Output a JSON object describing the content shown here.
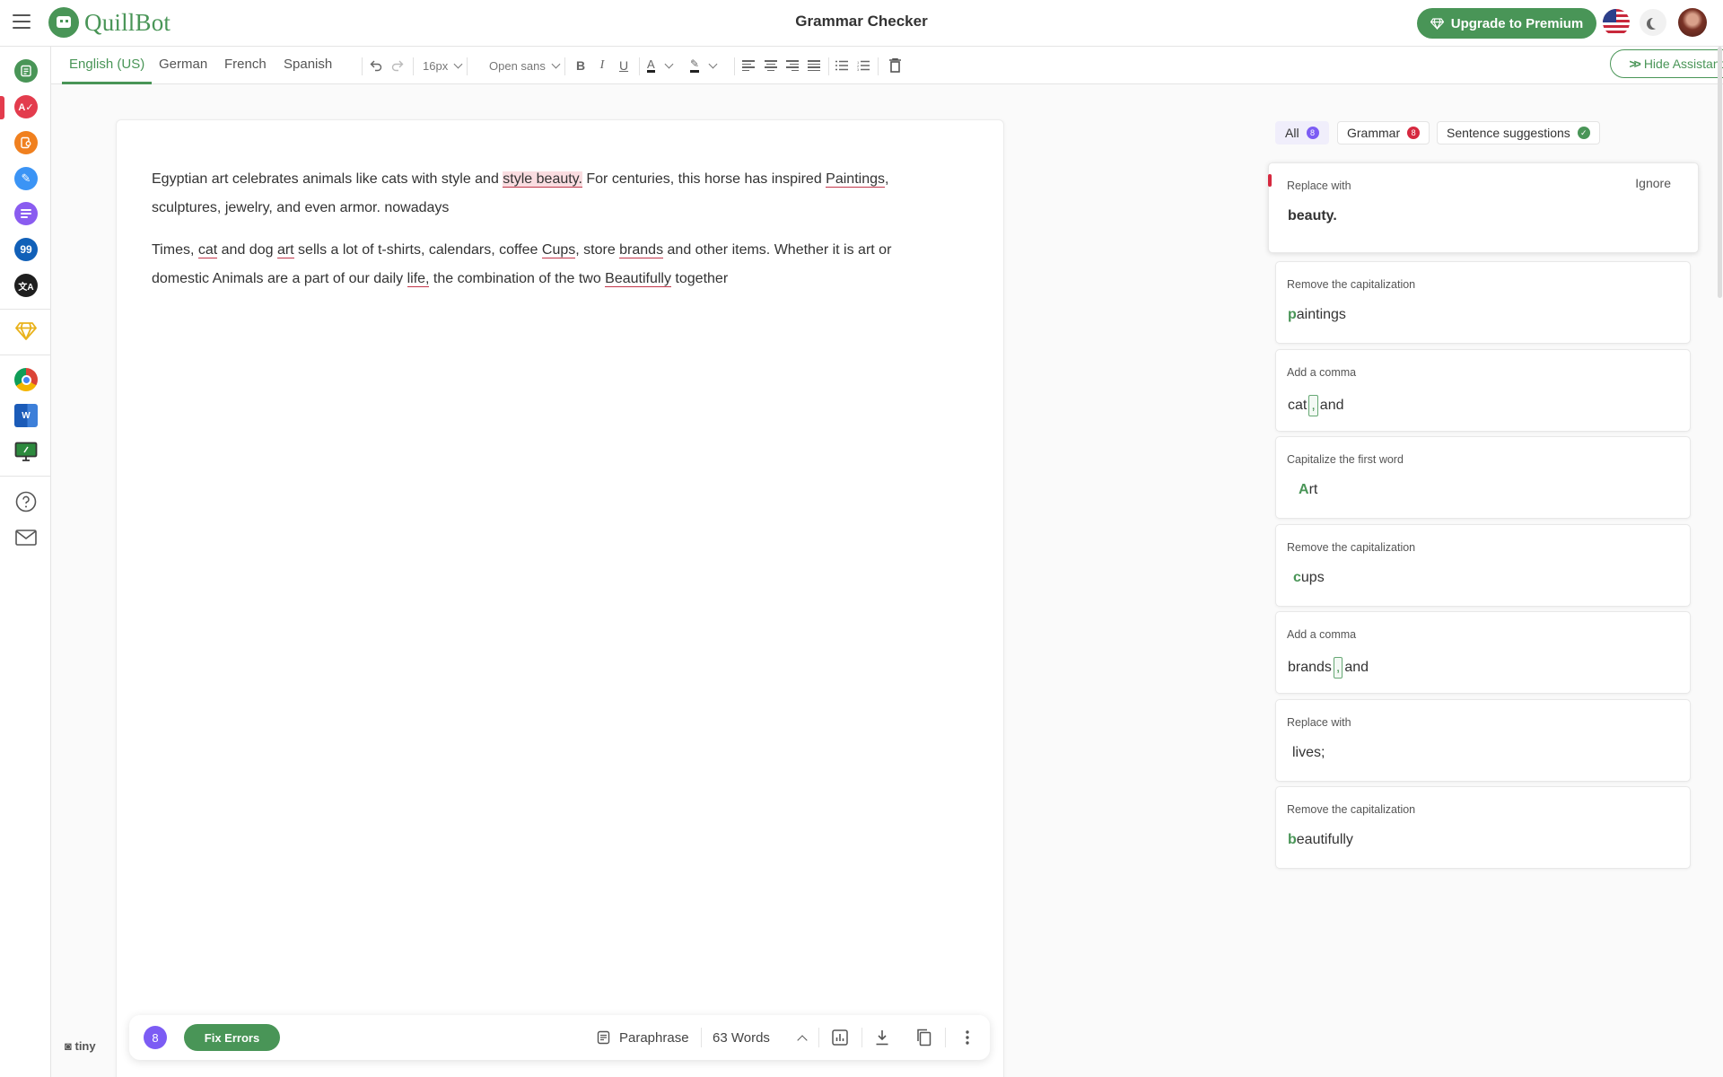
{
  "app": {
    "brand": "QuillBot",
    "page_title": "Grammar Checker",
    "upgrade_label": "Upgrade to Premium",
    "colors": {
      "brand_green": "#499557",
      "error_red": "#c2364a",
      "badge_purple": "#7c5cf4"
    }
  },
  "rail": {
    "items": [
      {
        "name": "paraphraser",
        "color": "#499557",
        "glyph": "⇄"
      },
      {
        "name": "grammar-checker",
        "color": "#e33c4d",
        "glyph": "A✓",
        "active": true
      },
      {
        "name": "plagiarism-checker",
        "color": "#f0801f",
        "glyph": "⌕"
      },
      {
        "name": "ai-writer",
        "color": "#3b94f5",
        "glyph": "✎"
      },
      {
        "name": "summarizer",
        "color": "#8a5cf0",
        "glyph": "≡"
      },
      {
        "name": "citation-generator",
        "color": "#1160b8",
        "glyph": "99"
      },
      {
        "name": "translator",
        "color": "#1e1e1e",
        "glyph": "文A"
      }
    ],
    "tiny_label": "tiny"
  },
  "toolbar": {
    "languages": [
      "English (US)",
      "German",
      "French",
      "Spanish"
    ],
    "active_language": "English (US)",
    "font_size": "16px",
    "font_family": "Open sans",
    "hide_assistant_label": "Hide Assistant"
  },
  "editor": {
    "p1": {
      "t1": "Egyptian art celebrates animals like cats with style and ",
      "e1": "style beauty.",
      "t2": " For centuries, this horse has inspired ",
      "e2": "Paintings",
      "t3": ", sculptures, jewelry, and even armor. nowadays"
    },
    "p2": {
      "t1": "Times, ",
      "e1": "cat",
      "t2": " and dog ",
      "e2": "art",
      "t3": " sells a lot of t-shirts, calendars, coffee ",
      "e3": "Cups",
      "t4": ", store ",
      "e4": "brands",
      "t5": " and other items. Whether it is art or domestic Animals are a part of our daily ",
      "e5": "life,",
      "t6": " the combination of the two ",
      "e6": "Beautifully",
      "t7": " together"
    }
  },
  "bottombar": {
    "error_count": "8",
    "fix_label": "Fix Errors",
    "paraphrase_label": "Paraphrase",
    "word_count": "63 Words"
  },
  "assistant": {
    "filters": [
      {
        "label": "All",
        "count": "8"
      },
      {
        "label": "Grammar",
        "count": "8"
      },
      {
        "label": "Sentence suggestions",
        "status": "check"
      }
    ],
    "ignore_label": "Ignore",
    "cards": [
      {
        "label": "Replace with",
        "suggestion": "beauty."
      },
      {
        "label": "Remove the capitalization",
        "highlight": "p",
        "rest": "aintings"
      },
      {
        "label": "Add a comma",
        "before": "cat",
        "insert": ",",
        "after": "and"
      },
      {
        "label": "Capitalize the first word",
        "highlight": "A",
        "rest": "rt"
      },
      {
        "label": "Remove the capitalization",
        "highlight": "c",
        "rest": "ups"
      },
      {
        "label": "Add a comma",
        "before": "brands",
        "insert": ",",
        "after": "and"
      },
      {
        "label": "Replace with",
        "suggestion": "lives;"
      },
      {
        "label": "Remove the capitalization",
        "highlight": "b",
        "rest": "eautifully"
      }
    ]
  }
}
